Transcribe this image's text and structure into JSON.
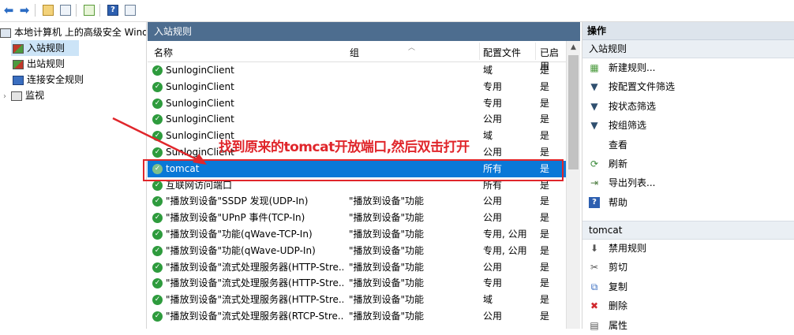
{
  "toolbar": {
    "buttons": [
      "back-icon",
      "forward-icon",
      "up-folder-icon",
      "show-hide-tree-icon",
      "export-icon",
      "help-icon",
      "properties-icon"
    ]
  },
  "tree": {
    "root": "本地计算机 上的高级安全 Windows",
    "items": [
      "入站规则",
      "出站规则",
      "连接安全规则",
      "监视"
    ]
  },
  "middle": {
    "header": "入站规则",
    "columns": {
      "name": "名称",
      "group": "组",
      "profile": "配置文件",
      "enabled": "已启用"
    },
    "rows": [
      {
        "name": "SunloginClient",
        "group": "",
        "profile": "域",
        "enabled": "是"
      },
      {
        "name": "SunloginClient",
        "group": "",
        "profile": "专用",
        "enabled": "是"
      },
      {
        "name": "SunloginClient",
        "group": "",
        "profile": "专用",
        "enabled": "是"
      },
      {
        "name": "SunloginClient",
        "group": "",
        "profile": "公用",
        "enabled": "是"
      },
      {
        "name": "SunloginClient",
        "group": "",
        "profile": "域",
        "enabled": "是"
      },
      {
        "name": "SunloginClient",
        "group": "",
        "profile": "公用",
        "enabled": "是"
      },
      {
        "name": "tomcat",
        "group": "",
        "profile": "所有",
        "enabled": "是"
      },
      {
        "name": "互联网访问端口",
        "group": "",
        "profile": "所有",
        "enabled": "是"
      },
      {
        "name": "\"播放到设备\"SSDP 发现(UDP-In)",
        "group": "\"播放到设备\"功能",
        "profile": "公用",
        "enabled": "是"
      },
      {
        "name": "\"播放到设备\"UPnP 事件(TCP-In)",
        "group": "\"播放到设备\"功能",
        "profile": "公用",
        "enabled": "是"
      },
      {
        "name": "\"播放到设备\"功能(qWave-TCP-In)",
        "group": "\"播放到设备\"功能",
        "profile": "专用, 公用",
        "enabled": "是"
      },
      {
        "name": "\"播放到设备\"功能(qWave-UDP-In)",
        "group": "\"播放到设备\"功能",
        "profile": "专用, 公用",
        "enabled": "是"
      },
      {
        "name": "\"播放到设备\"流式处理服务器(HTTP-Stre...",
        "group": "\"播放到设备\"功能",
        "profile": "公用",
        "enabled": "是"
      },
      {
        "name": "\"播放到设备\"流式处理服务器(HTTP-Stre...",
        "group": "\"播放到设备\"功能",
        "profile": "专用",
        "enabled": "是"
      },
      {
        "name": "\"播放到设备\"流式处理服务器(HTTP-Stre...",
        "group": "\"播放到设备\"功能",
        "profile": "域",
        "enabled": "是"
      },
      {
        "name": "\"播放到设备\"流式处理服务器(RTCP-Stre...",
        "group": "\"播放到设备\"功能",
        "profile": "公用",
        "enabled": "是"
      }
    ]
  },
  "right": {
    "header": "操作",
    "section1": "入站规则",
    "actions1": [
      {
        "label": "新建规则...",
        "icon": "new-rule-icon"
      },
      {
        "label": "按配置文件筛选",
        "icon": "filter-icon"
      },
      {
        "label": "按状态筛选",
        "icon": "filter-icon"
      },
      {
        "label": "按组筛选",
        "icon": "filter-icon"
      },
      {
        "label": "查看",
        "icon": ""
      },
      {
        "label": "刷新",
        "icon": "refresh-icon"
      },
      {
        "label": "导出列表...",
        "icon": "export-icon"
      },
      {
        "label": "帮助",
        "icon": "help-icon"
      }
    ],
    "section2": "tomcat",
    "actions2": [
      {
        "label": "禁用规则",
        "icon": "disable-icon"
      },
      {
        "label": "剪切",
        "icon": "cut-icon"
      },
      {
        "label": "复制",
        "icon": "copy-icon"
      },
      {
        "label": "删除",
        "icon": "delete-icon"
      },
      {
        "label": "属性",
        "icon": "properties-icon"
      }
    ]
  },
  "annotation": {
    "text": "找到原来的tomcat开放端口,然后双击打开"
  },
  "colors": {
    "accent": "#0a78d7",
    "header": "#4d6d8f",
    "annotation": "#e0262b",
    "enabled_green": "#2e9b3d"
  }
}
